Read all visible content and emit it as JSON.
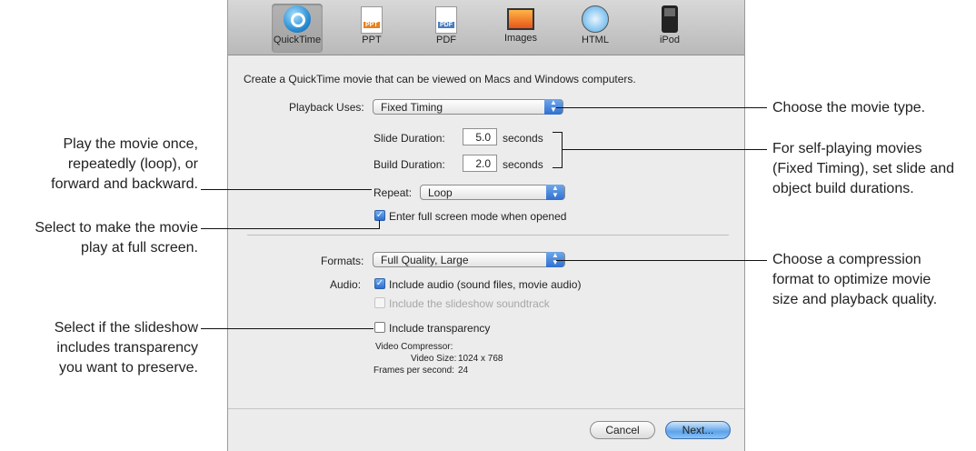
{
  "toolbar": {
    "tabs": [
      {
        "label": "QuickTime",
        "icon": "quicktime-icon",
        "selected": true
      },
      {
        "label": "PPT",
        "icon": "ppt-document-icon",
        "badge": "PPT"
      },
      {
        "label": "PDF",
        "icon": "pdf-document-icon",
        "badge": "PDF"
      },
      {
        "label": "Images",
        "icon": "image-icon"
      },
      {
        "label": "HTML",
        "icon": "safari-compass-icon"
      },
      {
        "label": "iPod",
        "icon": "ipod-icon"
      }
    ]
  },
  "main": {
    "description": "Create a QuickTime movie that can be viewed on Macs and Windows computers.",
    "playback_label": "Playback Uses:",
    "playback_value": "Fixed Timing",
    "slide_duration_label": "Slide Duration:",
    "slide_duration_value": "5.0",
    "build_duration_label": "Build Duration:",
    "build_duration_value": "2.0",
    "seconds": "seconds",
    "repeat_label": "Repeat:",
    "repeat_value": "Loop",
    "fullscreen_label": "Enter full screen mode when opened",
    "formats_label": "Formats:",
    "formats_value": "Full Quality, Large",
    "audio_label": "Audio:",
    "include_audio_label": "Include audio (sound files, movie audio)",
    "include_soundtrack_label": "Include the slideshow soundtrack",
    "include_transparency_label": "Include transparency",
    "video_compressor_label": "Video Compressor:",
    "video_size_label": "Video Size:",
    "video_size_value": "1024 x 768",
    "fps_label": "Frames per second:",
    "fps_value": "24"
  },
  "buttons": {
    "cancel": "Cancel",
    "next": "Next..."
  },
  "callouts": {
    "play_movie": [
      "Play the movie once,",
      "repeatedly (loop), or",
      "forward and backward."
    ],
    "full_screen": [
      "Select to make the movie",
      "play at full screen."
    ],
    "transparency": [
      "Select if the slideshow",
      "includes transparency",
      "you want to preserve."
    ],
    "movie_type": [
      "Choose the movie type."
    ],
    "self_playing": [
      "For self-playing movies",
      "(Fixed Timing), set slide and",
      "object build durations."
    ],
    "compression": [
      "Choose a compression",
      "format to optimize movie",
      "size and playback quality."
    ]
  },
  "colors": {
    "accent": "#2f6fd1",
    "dialog_bg": "#ececec"
  }
}
